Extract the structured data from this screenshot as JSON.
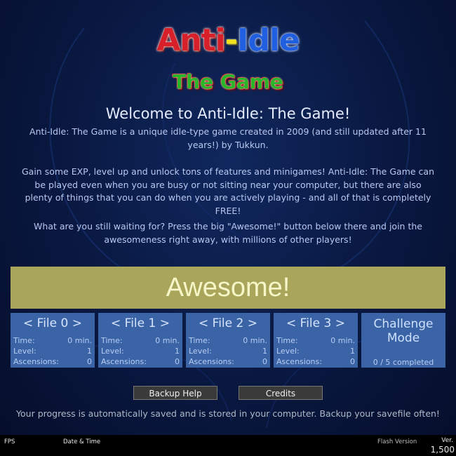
{
  "logo": {
    "title_part1": "Anti",
    "dash": "-",
    "title_part2": "Idle",
    "subtitle": "The Game"
  },
  "welcome": "Welcome to Anti-Idle: The Game!",
  "description": {
    "p1": "Anti-Idle: The Game is a unique idle-type game created in 2009 (and still updated after 11 years!) by Tukkun.",
    "p2": "Gain some EXP, level up and unlock tons of features and minigames! Anti-Idle: The Game can be played even when you are busy or not sitting near your computer, but there are also plenty of things that you can do when you are actively playing - and all of that is completely FREE!",
    "p3": "What are you still waiting for? Press the big \"Awesome!\" button below there and join the awesomeness right away, with millions of other players!"
  },
  "awesome_button": "Awesome!",
  "files": [
    {
      "title": "< File 0 >",
      "time_label": "Time:",
      "time": "0 min.",
      "level_label": "Level:",
      "level": "1",
      "asc_label": "Ascensions:",
      "ascensions": "0"
    },
    {
      "title": "< File 1 >",
      "time_label": "Time:",
      "time": "0 min.",
      "level_label": "Level:",
      "level": "1",
      "asc_label": "Ascensions:",
      "ascensions": "0"
    },
    {
      "title": "< File 2 >",
      "time_label": "Time:",
      "time": "0 min.",
      "level_label": "Level:",
      "level": "1",
      "asc_label": "Ascensions:",
      "ascensions": "0"
    },
    {
      "title": "< File 3 >",
      "time_label": "Time:",
      "time": "0 min.",
      "level_label": "Level:",
      "level": "1",
      "asc_label": "Ascensions:",
      "ascensions": "0"
    }
  ],
  "challenge": {
    "title_line1": "Challenge",
    "title_line2": "Mode",
    "progress": "0 / 5 completed"
  },
  "buttons": {
    "backup_help": "Backup Help",
    "credits": "Credits"
  },
  "progress_note": "Your progress is automatically saved and is stored in your computer. Backup your savefile often!",
  "footer": {
    "fps": "FPS",
    "date_time": "Date & Time",
    "flash_version": "Flash Version",
    "ver_label": "Ver.",
    "version": "1,500"
  },
  "colors": {
    "background": "#0a1a44",
    "panel": "#3a64a6",
    "awesome_button": "#a9a55a",
    "footer": "#000000"
  }
}
